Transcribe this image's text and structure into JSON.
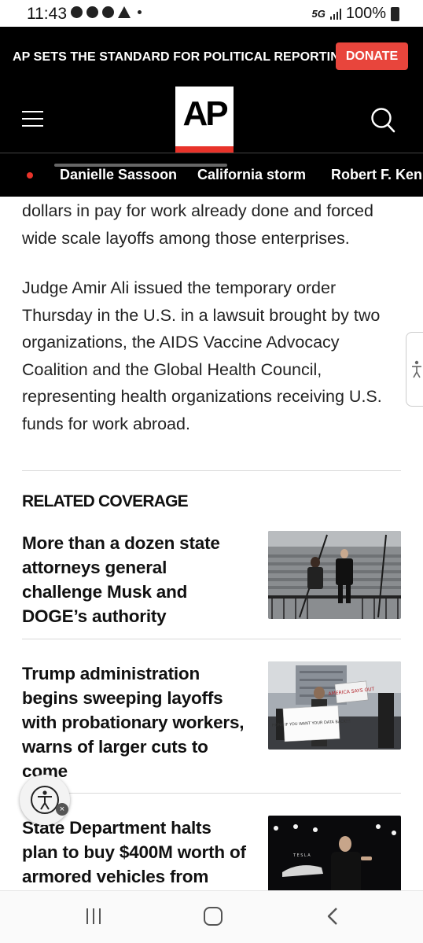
{
  "status_bar": {
    "time": "11:43",
    "network": "5G",
    "battery": "100%"
  },
  "header": {
    "promo": "AP SETS THE STANDARD FOR POLITICAL REPORTING.",
    "donate_label": "DONATE",
    "logo_text": "AP",
    "accent_color": "#e8453c"
  },
  "trending": {
    "items": [
      {
        "label": "Danielle Sassoon"
      },
      {
        "label": "California storm"
      },
      {
        "label": "Robert F. Kennedy"
      }
    ]
  },
  "article": {
    "paragraph_1": "dollars in pay for work already done and forced wide scale layoffs among those enterprises.",
    "paragraph_2": "Judge Amir Ali issued the temporary order Thursday in the U.S. in a lawsuit brought by two organizations, the AIDS Vaccine Advocacy Coalition and the Global Health Council, representing health organizations receiving U.S. funds for work abroad."
  },
  "related": {
    "heading": "RELATED COVERAGE",
    "items": [
      {
        "title": "More than a dozen state attorneys general challenge Musk and DOGE’s authority",
        "image": "people-walking-down-courthouse-steps"
      },
      {
        "title": "Trump administration begins sweeping layoffs with probationary workers, warns of larger cuts to come",
        "image": "protesters-holding-signs",
        "sign_1": "HONK IF YOU WANT YOUR DATA BACK!!!",
        "sign_2": "AMERICA SAYS OUT"
      },
      {
        "title": "State Department halts plan to buy $400M worth of armored vehicles from",
        "image": "speaker-on-stage-with-vehicle",
        "stage_text": "TESLA"
      }
    ]
  },
  "icons": {
    "menu": "hamburger-menu-icon",
    "search": "search-icon",
    "accessibility": "accessibility-icon",
    "nav_recents": "recents-icon",
    "nav_home": "home-icon",
    "nav_back": "back-icon"
  }
}
